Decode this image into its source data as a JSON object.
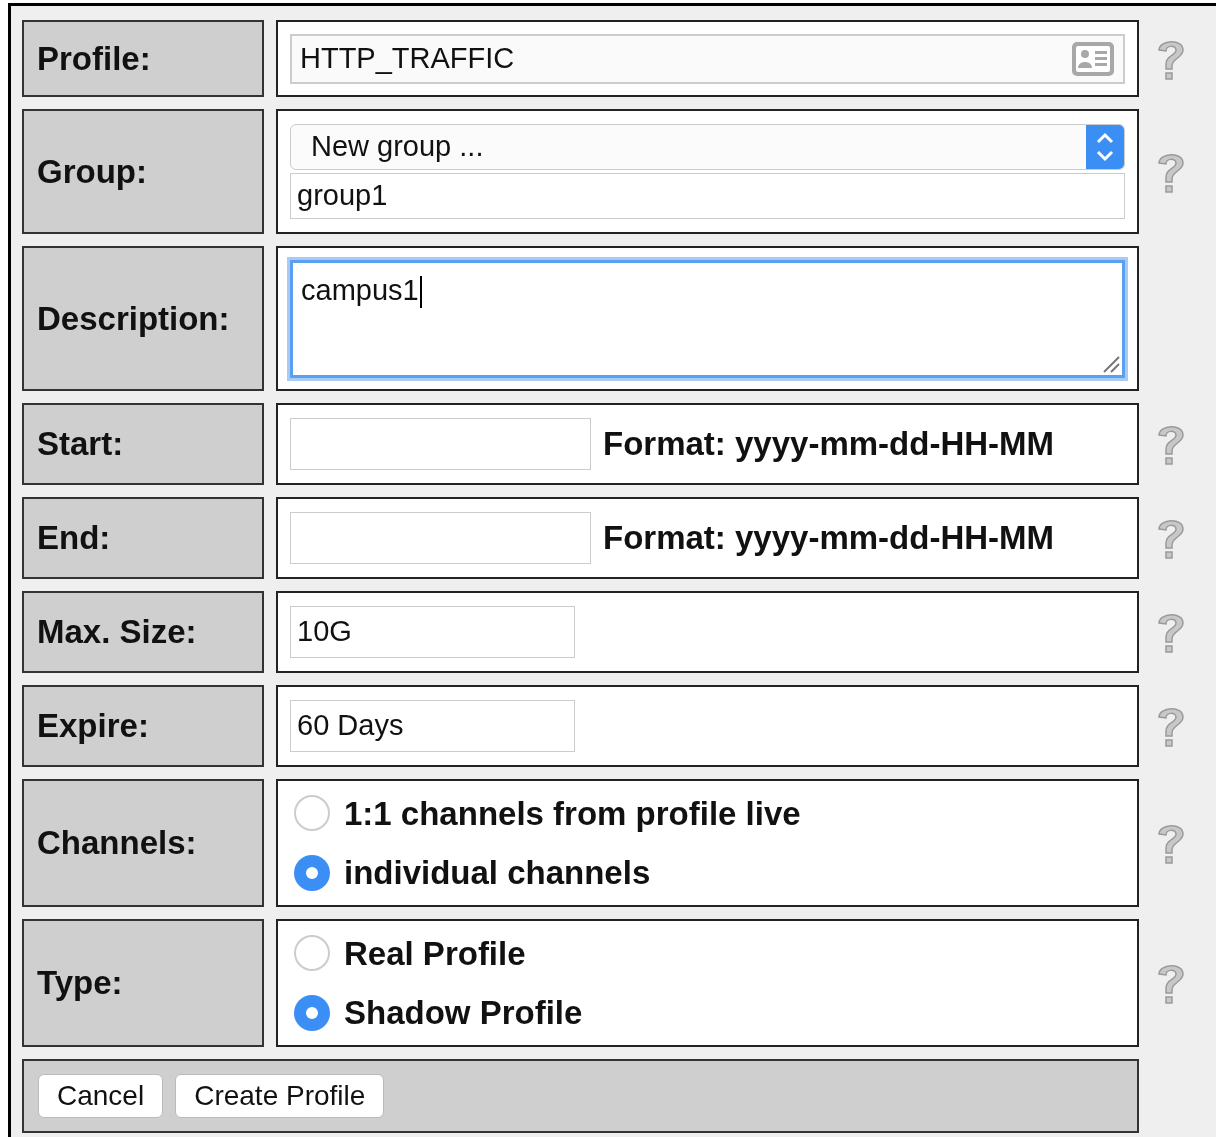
{
  "rows": [
    {
      "kind": "text_icon",
      "label": "Profile:",
      "value": "HTTP_TRAFFIC",
      "help": true
    },
    {
      "kind": "select_text",
      "label": "Group:",
      "select": "New group ...",
      "value": "group1",
      "help": true
    },
    {
      "kind": "textarea",
      "label": "Description:",
      "value": "campus1",
      "focused": true,
      "help": false
    },
    {
      "kind": "date",
      "label": "Start:",
      "format": "Format: yyyy-mm-dd-HH-MM",
      "help": true
    },
    {
      "kind": "date",
      "label": "End:",
      "format": "Format: yyyy-mm-dd-HH-MM",
      "help": true
    },
    {
      "kind": "text",
      "label": "Max. Size:",
      "value": "10G",
      "help": true
    },
    {
      "kind": "text",
      "label": "Expire:",
      "value": "60 Days",
      "help": true
    },
    {
      "kind": "radio",
      "label": "Channels:",
      "options": [
        {
          "label": "1:1 channels from profile live",
          "selected": false
        },
        {
          "label": "individual channels",
          "selected": true
        }
      ],
      "help": true
    },
    {
      "kind": "radio",
      "label": "Type:",
      "options": [
        {
          "label": "Real Profile",
          "selected": false
        },
        {
          "label": "Shadow Profile",
          "selected": true
        }
      ],
      "help": true
    }
  ],
  "buttons": [
    "Cancel",
    "Create Profile"
  ]
}
